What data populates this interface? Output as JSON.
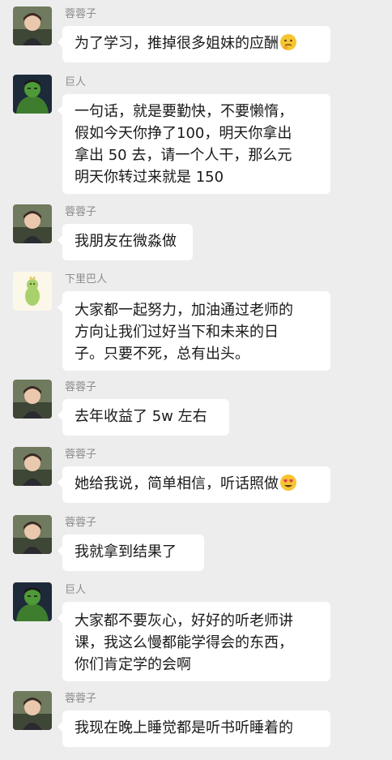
{
  "messages": [
    {
      "sender": "蓉蓉子",
      "avatar_icon": "girl-avatar",
      "lines": [
        "为了学习，推掉很多姐妹的应酬"
      ],
      "emoji": "thinking-face-icon"
    },
    {
      "sender": "巨人",
      "avatar_icon": "hulk-avatar",
      "lines": [
        "一句话，就是要勤快，不要懒惰，",
        "假如今天你挣了100，明天你拿出",
        "拿出 50 去，请一个人干，那么元",
        "明天你转过来就是 150"
      ]
    },
    {
      "sender": "蓉蓉子",
      "avatar_icon": "girl-avatar",
      "lines": [
        "我朋友在微淼做"
      ]
    },
    {
      "sender": "下里巴人",
      "avatar_icon": "cartoon-dino-avatar",
      "lines": [
        "大家都一起努力，加油通过老师的",
        "方向让我们过好当下和未来的日",
        "子。只要不死，总有出头。"
      ]
    },
    {
      "sender": "蓉蓉子",
      "avatar_icon": "girl-avatar",
      "lines": [
        "去年收益了 5w 左右"
      ]
    },
    {
      "sender": "蓉蓉子",
      "avatar_icon": "girl-avatar",
      "lines": [
        "她给我说，简单相信，听话照做"
      ],
      "emoji": "heart-eyes-face-icon"
    },
    {
      "sender": "蓉蓉子",
      "avatar_icon": "girl-avatar",
      "lines": [
        "我就拿到结果了"
      ]
    },
    {
      "sender": "巨人",
      "avatar_icon": "hulk-avatar",
      "lines": [
        "大家都不要灰心，好好的听老师讲",
        "课，我这么慢都能学得会的东西，",
        "你们肯定学的会啊"
      ]
    },
    {
      "sender": "蓉蓉子",
      "avatar_icon": "girl-avatar",
      "lines": [
        "我现在晚上睡觉都是听书听睡着的"
      ]
    }
  ],
  "colors": {
    "background": "#ededed",
    "bubble": "#ffffff",
    "name": "#8c8c8c",
    "text": "#1a1a1a"
  }
}
